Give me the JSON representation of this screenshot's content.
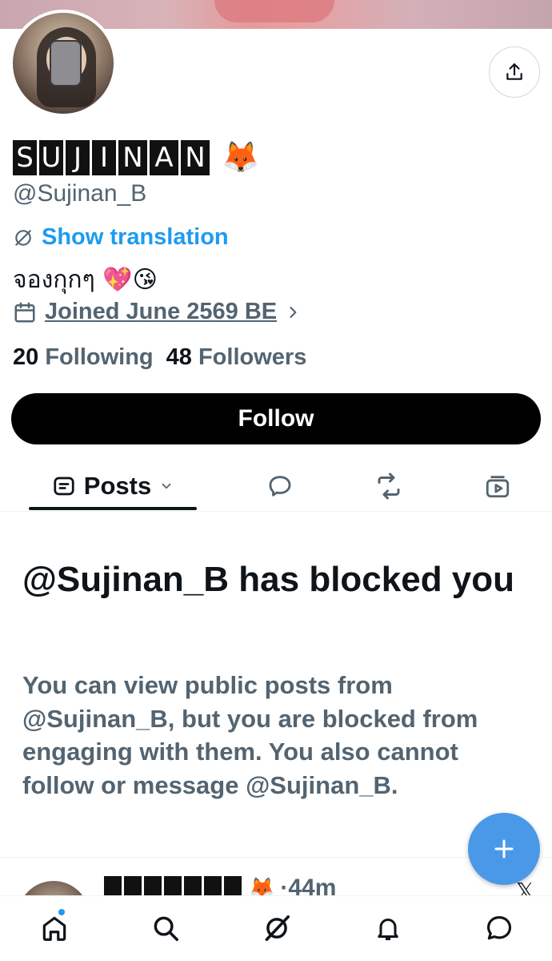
{
  "profile": {
    "display_name_letters": [
      "S",
      "U",
      "J",
      "I",
      "N",
      "A",
      "N"
    ],
    "display_name_emoji": "🦊",
    "handle": "@Sujinan_B",
    "show_translation": "Show translation",
    "bio": "จองกุกๆ 💖😘",
    "joined": "Joined June 2569 BE",
    "following_count": "20",
    "following_label": "Following",
    "followers_count": "48",
    "followers_label": "Followers"
  },
  "actions": {
    "follow": "Follow"
  },
  "tabs": {
    "posts_label": "Posts"
  },
  "blocked": {
    "title": "@Sujinan_B has blocked you",
    "body": "You can view public posts from @Sujinan_B, but you are blocked from engaging with them. You also cannot follow or message @Sujinan_B."
  },
  "peek_post": {
    "emoji": "🦊",
    "time": "·44m",
    "x_logo": "𝕏"
  },
  "colors": {
    "accent": "#1d9bf0",
    "fab": "#4a99e9",
    "secondary_text": "#536471",
    "primary_text": "#0f1419"
  },
  "icons": {
    "share": "share-icon",
    "translate": "translate-globe-icon",
    "calendar": "calendar-icon",
    "chevron_right": "chevron-right-icon",
    "posts": "posts-tab-icon",
    "chevron_down": "chevron-down-icon",
    "replies": "reply-bubble-icon",
    "reposts": "repost-icon",
    "media": "media-icon",
    "compose": "plus-icon",
    "home": "home-icon",
    "search": "search-icon",
    "grok": "grok-icon",
    "notifications": "bell-icon",
    "messages": "message-icon"
  }
}
